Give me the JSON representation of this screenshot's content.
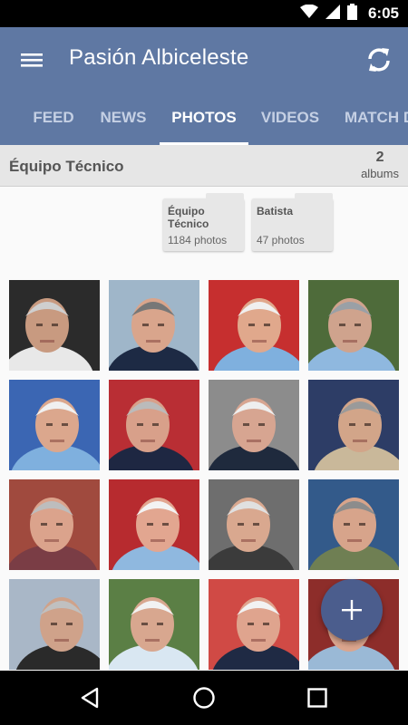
{
  "status_bar": {
    "time": "6:05",
    "icons": [
      "wifi-icon",
      "signal-icon",
      "battery-icon"
    ]
  },
  "app_bar": {
    "title": "Pasión Albiceleste",
    "menu_icon": "menu-icon",
    "refresh_icon": "refresh-icon"
  },
  "tabs": [
    {
      "label": "FEED",
      "active": false
    },
    {
      "label": "NEWS",
      "active": false
    },
    {
      "label": "PHOTOS",
      "active": true
    },
    {
      "label": "VIDEOS",
      "active": false
    },
    {
      "label": "MATCH D",
      "active": false
    }
  ],
  "section": {
    "title": "Équipo Técnico",
    "count": "2",
    "count_label": "albums"
  },
  "albums": [
    {
      "name": "Équipo Técnico",
      "count": "1184 photos"
    },
    {
      "name": "Batista",
      "count": "47 photos"
    }
  ],
  "photos": [
    {
      "bg": "#2b2b2b",
      "skin": "#c89a80",
      "shirt": "#e8e8e8",
      "hair": "#cfcfcf"
    },
    {
      "bg": "#9fb6c9",
      "skin": "#d9a58c",
      "shirt": "#1d2a44",
      "hair": "#777777"
    },
    {
      "bg": "#c62f2f",
      "skin": "#e0a88c",
      "shirt": "#7fb0de",
      "hair": "#f0f0f0"
    },
    {
      "bg": "#4e6b3a",
      "skin": "#cfa38d",
      "shirt": "#8fb8df",
      "hair": "#9aa0a6"
    },
    {
      "bg": "#3b66b3",
      "skin": "#dba78d",
      "shirt": "#7fb0de",
      "hair": "#f0f0f0"
    },
    {
      "bg": "#b92e34",
      "skin": "#d8a08a",
      "shirt": "#1e2742",
      "hair": "#bbbbbb"
    },
    {
      "bg": "#8c8c8c",
      "skin": "#d7a591",
      "shirt": "#1f2a3d",
      "hair": "#eeeeee"
    },
    {
      "bg": "#2d3d66",
      "skin": "#d2a589",
      "shirt": "#c9b89a",
      "hair": "#9a9a9a"
    },
    {
      "bg": "#a04a3e",
      "skin": "#dba38c",
      "shirt": "#7a3d45",
      "hair": "#bdbdbd"
    },
    {
      "bg": "#b72b2f",
      "skin": "#e2a690",
      "shirt": "#8fb8df",
      "hair": "#f3f3f3"
    },
    {
      "bg": "#6e6e6e",
      "skin": "#d9a88f",
      "shirt": "#3b3b3b",
      "hair": "#e0e0e0"
    },
    {
      "bg": "#335a8a",
      "skin": "#d7a48b",
      "shirt": "#6f7f53",
      "hair": "#8c8c8c"
    },
    {
      "bg": "#a9b7c7",
      "skin": "#cfa28a",
      "shirt": "#2a2a2a",
      "hair": "#c0c0c0"
    },
    {
      "bg": "#5b7f45",
      "skin": "#d8a78f",
      "shirt": "#d9e7f2",
      "hair": "#f2f2f2"
    },
    {
      "bg": "#d04a45",
      "skin": "#dfa48e",
      "shirt": "#1f2a44",
      "hair": "#f2f2f2"
    },
    {
      "bg": "#8d2d2a",
      "skin": "#dba58d",
      "shirt": "#9ab9d6",
      "hair": "#efefef"
    }
  ],
  "fab": {
    "icon": "plus-icon"
  },
  "nav_bar": {
    "icons": [
      "back-icon",
      "home-icon",
      "recents-icon"
    ]
  },
  "colors": {
    "primary": "#5f78a3",
    "accent": "#4b5d8d",
    "tab_inactive": "#c5d0e4"
  }
}
